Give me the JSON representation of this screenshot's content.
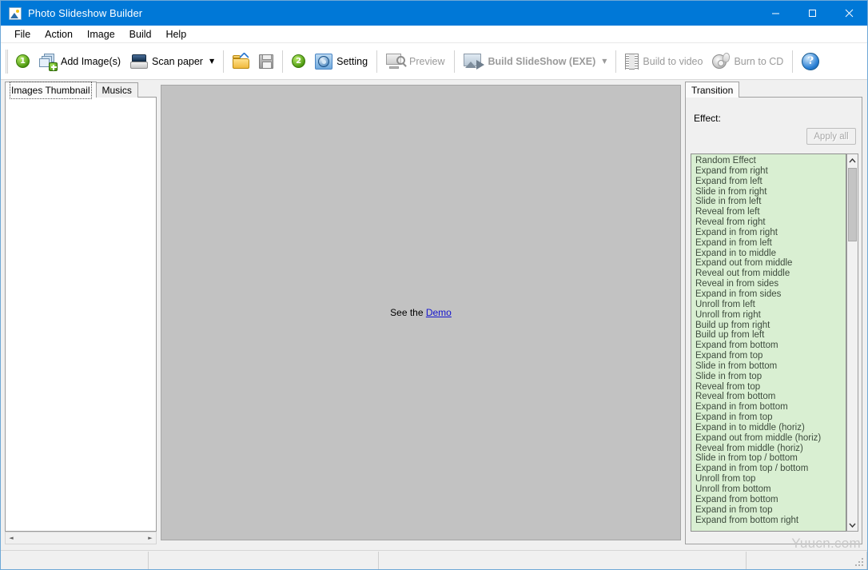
{
  "window": {
    "title": "Photo Slideshow Builder",
    "app_icon": "photo-icon",
    "minimize_label": "–",
    "maximize_label": "□",
    "close_label": "✕",
    "accent_color": "#0078d7"
  },
  "menubar": {
    "items": [
      {
        "label": "File"
      },
      {
        "label": "Action"
      },
      {
        "label": "Image"
      },
      {
        "label": "Build"
      },
      {
        "label": "Help"
      }
    ]
  },
  "toolbar": {
    "step1_badge": "1",
    "step2_badge": "2",
    "add_images_label": "Add Image(s)",
    "add_images_icon": "add-images-icon",
    "scan_paper_label": "Scan paper",
    "scan_paper_icon": "scanner-icon",
    "scan_paper_dropdown": "▼",
    "open_icon": "open-folder-icon",
    "save_icon": "save-disk-icon",
    "setting_label": "Setting",
    "setting_icon": "gear-icon",
    "preview_label": "Preview",
    "preview_icon": "preview-magnifier-icon",
    "build_slideshow_label": "Build SlideShow (EXE)",
    "build_slideshow_icon": "build-exe-icon",
    "build_slideshow_dropdown": "▼",
    "build_video_label": "Build to video",
    "build_video_icon": "film-strip-icon",
    "burn_cd_label": "Burn to CD",
    "burn_cd_icon": "burn-cd-icon",
    "help_label": "?",
    "help_icon": "help-icon"
  },
  "left_panel": {
    "tabs": [
      {
        "label": "Images Thumbnail",
        "active": true
      },
      {
        "label": "Musics",
        "active": false
      }
    ],
    "thumbnail_list_items": [],
    "hscroll_left": "◄",
    "hscroll_right": "►"
  },
  "center_panel": {
    "demo_prefix": "See the ",
    "demo_link": "Demo",
    "background_color": "#c2c2c2"
  },
  "right_panel": {
    "tabs": [
      {
        "label": "Transition",
        "active": true
      }
    ],
    "effect_label": "Effect:",
    "apply_all_label": "Apply all",
    "apply_all_enabled": false,
    "list_background": "#d9efd2",
    "scroll_up": "▲",
    "scroll_down": "▼",
    "effects": [
      "Random Effect",
      "Expand from right",
      "Expand from left",
      "Slide in from right",
      "Slide in from left",
      "Reveal from left",
      "Reveal from right",
      "Expand in from right",
      "Expand in from left",
      "Expand in to middle",
      "Expand out from middle",
      "Reveal out from middle",
      "Reveal in from sides",
      "Expand in from sides",
      "Unroll from left",
      "Unroll from right",
      "Build up from right",
      "Build up from left",
      "Expand from bottom",
      "Expand from top",
      "Slide in from bottom",
      "Slide in from top",
      "Reveal from top",
      "Reveal from bottom",
      "Expand in from bottom",
      "Expand in from top",
      "Expand in to middle (horiz)",
      "Expand out from middle (horiz)",
      "Reveal from middle (horiz)",
      "Slide in from top / bottom",
      "Expand in from top / bottom",
      "Unroll from top",
      "Unroll from bottom",
      "Expand from bottom",
      "Expand in from top",
      "Expand from bottom right"
    ]
  },
  "statusbar": {
    "cells": [
      "",
      "",
      "",
      ""
    ]
  },
  "watermark": "Yuucn.com"
}
